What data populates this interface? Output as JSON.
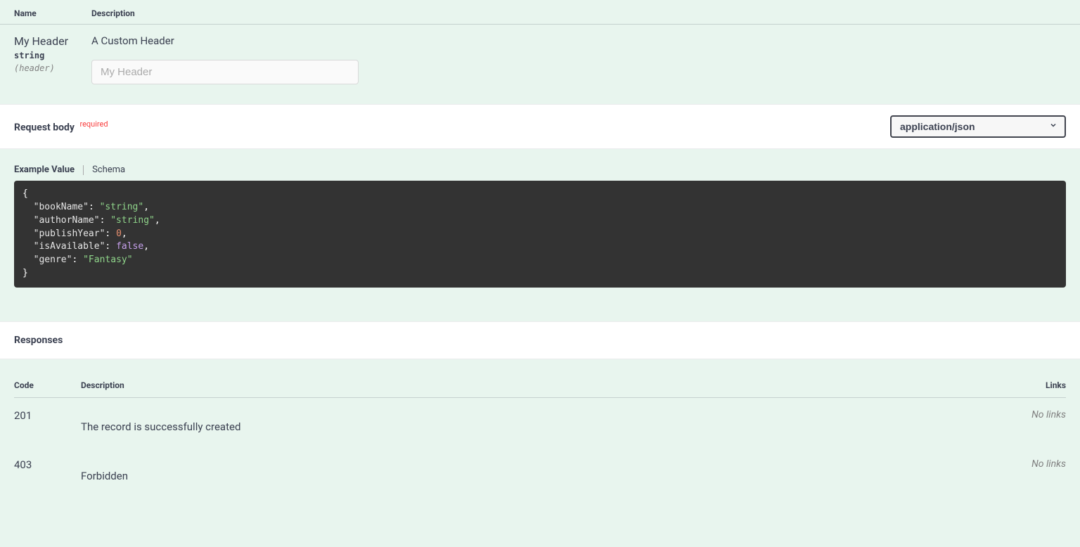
{
  "params_table": {
    "header_name": "Name",
    "header_desc": "Description"
  },
  "parameter": {
    "name": "My Header",
    "type": "string",
    "in": "(header)",
    "description": "A Custom Header",
    "placeholder": "My Header"
  },
  "request_body": {
    "title": "Request body",
    "required_label": "required",
    "content_type": "application/json",
    "tab_example": "Example Value",
    "tab_schema": "Schema",
    "example": {
      "bookName": "string",
      "authorName": "string",
      "publishYear": 0,
      "isAvailable": false,
      "genre": "Fantasy"
    }
  },
  "responses": {
    "title": "Responses",
    "header_code": "Code",
    "header_desc": "Description",
    "header_links": "Links",
    "no_links": "No links",
    "rows": [
      {
        "code": "201",
        "description": "The record is successfully created"
      },
      {
        "code": "403",
        "description": "Forbidden"
      }
    ]
  }
}
